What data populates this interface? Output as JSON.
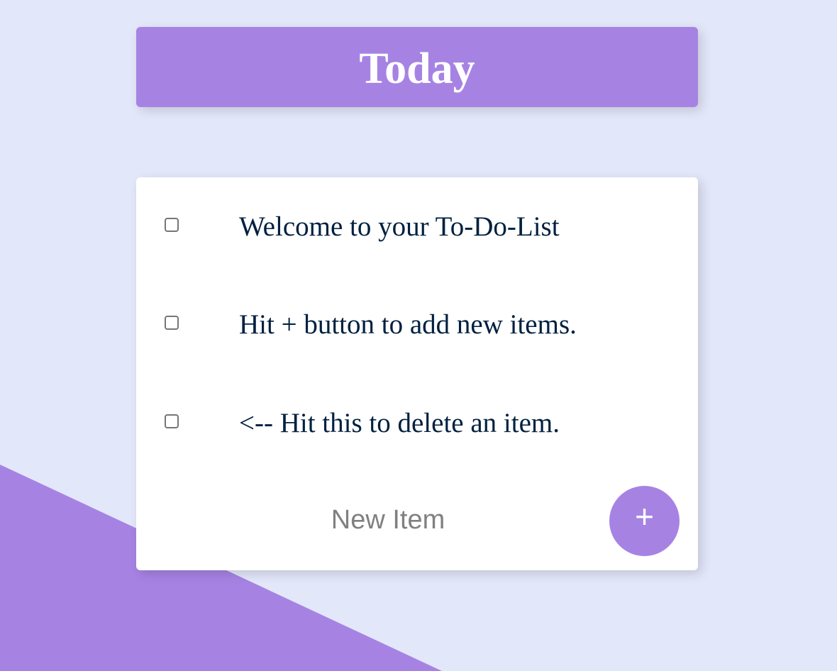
{
  "header": {
    "title": "Today"
  },
  "list": {
    "items": [
      {
        "label": "Welcome to your To-Do-List",
        "checked": false
      },
      {
        "label": "Hit + button to add new items.",
        "checked": false
      },
      {
        "label": "<-- Hit this to delete an item.",
        "checked": false
      }
    ],
    "new_item_placeholder": "New Item",
    "add_button_label": "+"
  },
  "colors": {
    "background": "#E3E7FA",
    "accent": "#A683E3",
    "card": "#FFFFFF",
    "item_text": "#00203F",
    "placeholder_text": "#808080"
  }
}
